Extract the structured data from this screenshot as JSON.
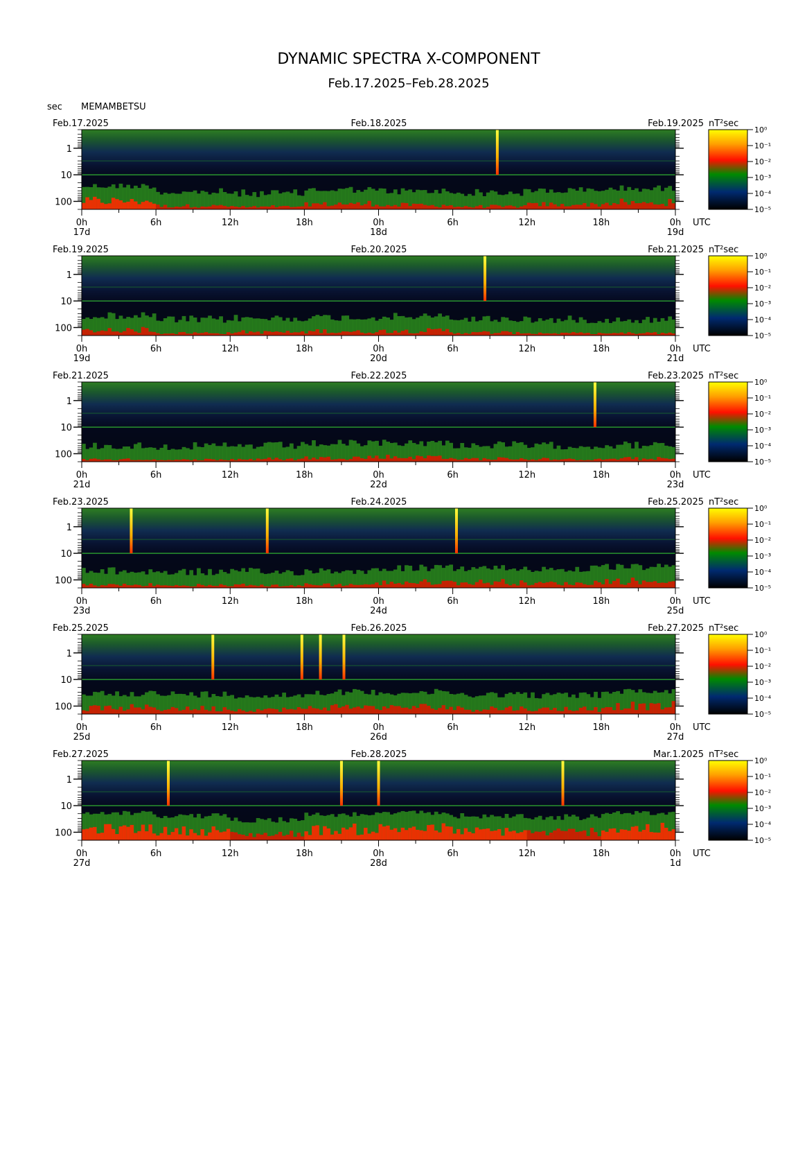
{
  "title": "DYNAMIC SPECTRA X-COMPONENT",
  "subtitle": "Feb.17.2025–Feb.28.2025",
  "y_unit": "sec",
  "station": "MEMAMBETSU",
  "time_zone": "UTC",
  "colorbar_unit": "nT²sec",
  "colorbar_ticks": [
    "10⁰",
    "10⁻¹",
    "10⁻²",
    "10⁻³",
    "10⁻⁴",
    "10⁻⁵"
  ],
  "colorbar_colors": [
    "#ffff00",
    "#ffa000",
    "#ff0000",
    "#00a000",
    "#002060",
    "#000000"
  ],
  "chart_data": {
    "type": "heatmap",
    "xlabel": "UTC",
    "ylabel": "sec",
    "y_scale": "log",
    "y_range": [
      0.2,
      200
    ],
    "y_ticks": [
      "1",
      "10",
      "100"
    ],
    "x_tick_labels": [
      "0h",
      "6h",
      "12h",
      "18h",
      "0h",
      "6h",
      "12h",
      "18h",
      "0h"
    ],
    "value_scale": "log",
    "value_range": [
      1e-05,
      1
    ],
    "panels": [
      {
        "left_date": "Feb.17.2025",
        "mid_date": "Feb.18.2025",
        "right_date": "Feb.19.2025",
        "day_labels": [
          "17d",
          "18d",
          "19d"
        ],
        "spikes": [
          33.6
        ],
        "activity": [
          0.72,
          0.4,
          0.3,
          0.55,
          0.45,
          0.35,
          0.5,
          0.6
        ]
      },
      {
        "left_date": "Feb.19.2025",
        "mid_date": "Feb.20.2025",
        "right_date": "Feb.21.2025",
        "day_labels": [
          "19d",
          "20d",
          "21d"
        ],
        "spikes": [
          32.6
        ],
        "activity": [
          0.55,
          0.3,
          0.4,
          0.45,
          0.5,
          0.35,
          0.3,
          0.3
        ]
      },
      {
        "left_date": "Feb.21.2025",
        "mid_date": "Feb.22.2025",
        "right_date": "Feb.23.2025",
        "day_labels": [
          "21d",
          "22d",
          "23d"
        ],
        "spikes": [
          41.5
        ],
        "activity": [
          0.3,
          0.25,
          0.3,
          0.45,
          0.5,
          0.35,
          0.3,
          0.35
        ]
      },
      {
        "left_date": "Feb.23.2025",
        "mid_date": "Feb.24.2025",
        "right_date": "Feb.25.2025",
        "day_labels": [
          "23d",
          "24d",
          "25d"
        ],
        "spikes": [
          4.0,
          15.0,
          30.3
        ],
        "activity": [
          0.35,
          0.3,
          0.3,
          0.4,
          0.55,
          0.55,
          0.5,
          0.6
        ]
      },
      {
        "left_date": "Feb.25.2025",
        "mid_date": "Feb.26.2025",
        "right_date": "Feb.27.2025",
        "day_labels": [
          "25d",
          "26d",
          "27d"
        ],
        "spikes": [
          10.6,
          17.8,
          19.3,
          21.2
        ],
        "activity": [
          0.6,
          0.55,
          0.5,
          0.65,
          0.65,
          0.55,
          0.5,
          0.7
        ]
      },
      {
        "left_date": "Feb.27.2025",
        "mid_date": "Feb.28.2025",
        "right_date": "Mar.1.2025",
        "day_labels": [
          "27d",
          "28d",
          "1d"
        ],
        "spikes": [
          7.0,
          21.0,
          24.0,
          38.9
        ],
        "activity": [
          0.85,
          0.75,
          0.6,
          0.8,
          0.85,
          0.75,
          0.7,
          0.85
        ]
      }
    ]
  }
}
